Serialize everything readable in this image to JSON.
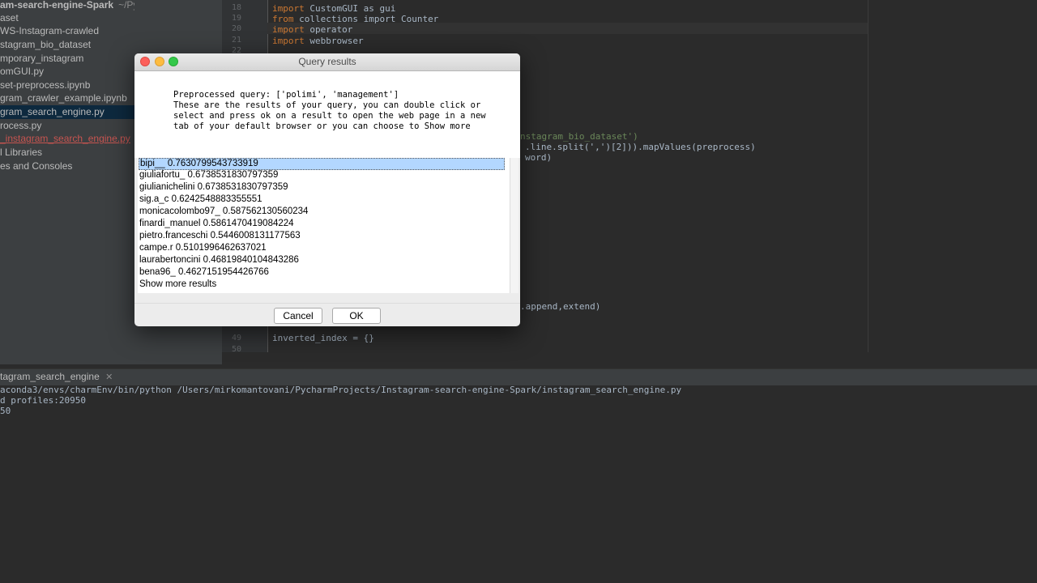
{
  "project": {
    "root_label": "am-search-engine-Spark",
    "root_path": "~/PycharmProjects/Instag",
    "items": [
      "aset",
      "WS-Instagram-crawled",
      "stagram_bio_dataset",
      "mporary_instagram",
      "omGUI.py",
      "set-preprocess.ipynb",
      "gram_crawler_example.ipynb",
      "gram_search_engine.py",
      "rocess.py",
      "_instagram_search_engine.py",
      "l Libraries",
      "es and Consoles"
    ]
  },
  "editor": {
    "lines": [
      {
        "num": "18",
        "kw": "import",
        "rest": " CustomGUI as gui"
      },
      {
        "num": "19",
        "kw": "from",
        "rest": " collections import Counter"
      },
      {
        "num": "20",
        "kw": "import",
        "rest": " operator"
      },
      {
        "num": "21",
        "kw": "import",
        "rest": " webbrowser"
      },
      {
        "num": "22",
        "kw": "",
        "rest": ""
      }
    ],
    "frag1": "nstagram_bio_dataset')",
    "frag2": ".line.split(',')[2])).mapValues(preprocess)",
    "frag3": "word)",
    "frag4": ".append,extend)",
    "line49": {
      "num": "49",
      "text": "inverted_index = {}"
    },
    "line50": {
      "num": "50"
    }
  },
  "run": {
    "tab_label": "tagram_search_engine",
    "line1": "aconda3/envs/charmEnv/bin/python /Users/mirkomantovani/PycharmProjects/Instagram-search-engine-Spark/instagram_search_engine.py",
    "line2": "d profiles:20950",
    "line3": "50"
  },
  "dialog": {
    "title": "Query results",
    "message": [
      "Preprocessed query: ['polimi', 'management']",
      "These are the results of your query, you can double click or",
      "select and press ok on a result to open the web page in a new",
      "tab of your default browser or you can choose to Show more"
    ],
    "results": [
      "bipi__ 0.7630799543733919",
      "giuliafortu_ 0.6738531830797359",
      "giulianichelini 0.6738531830797359",
      "sig.a_c 0.6242548883355551",
      "monicacolombo97_ 0.587562130560234",
      "finardi_manuel 0.5861470419084224",
      "pietro.franceschi 0.5446008131177563",
      "campe.r 0.5101996462637021",
      "laurabertoncini 0.46819840104843286",
      "bena96_ 0.4627151954426766",
      "Show more results"
    ],
    "cancel_label": "Cancel",
    "ok_label": "OK"
  },
  "colors": {
    "close": "#fc605b",
    "minimize": "#fdbc40",
    "zoom": "#34c84a",
    "selection": "#b3d7ff"
  }
}
